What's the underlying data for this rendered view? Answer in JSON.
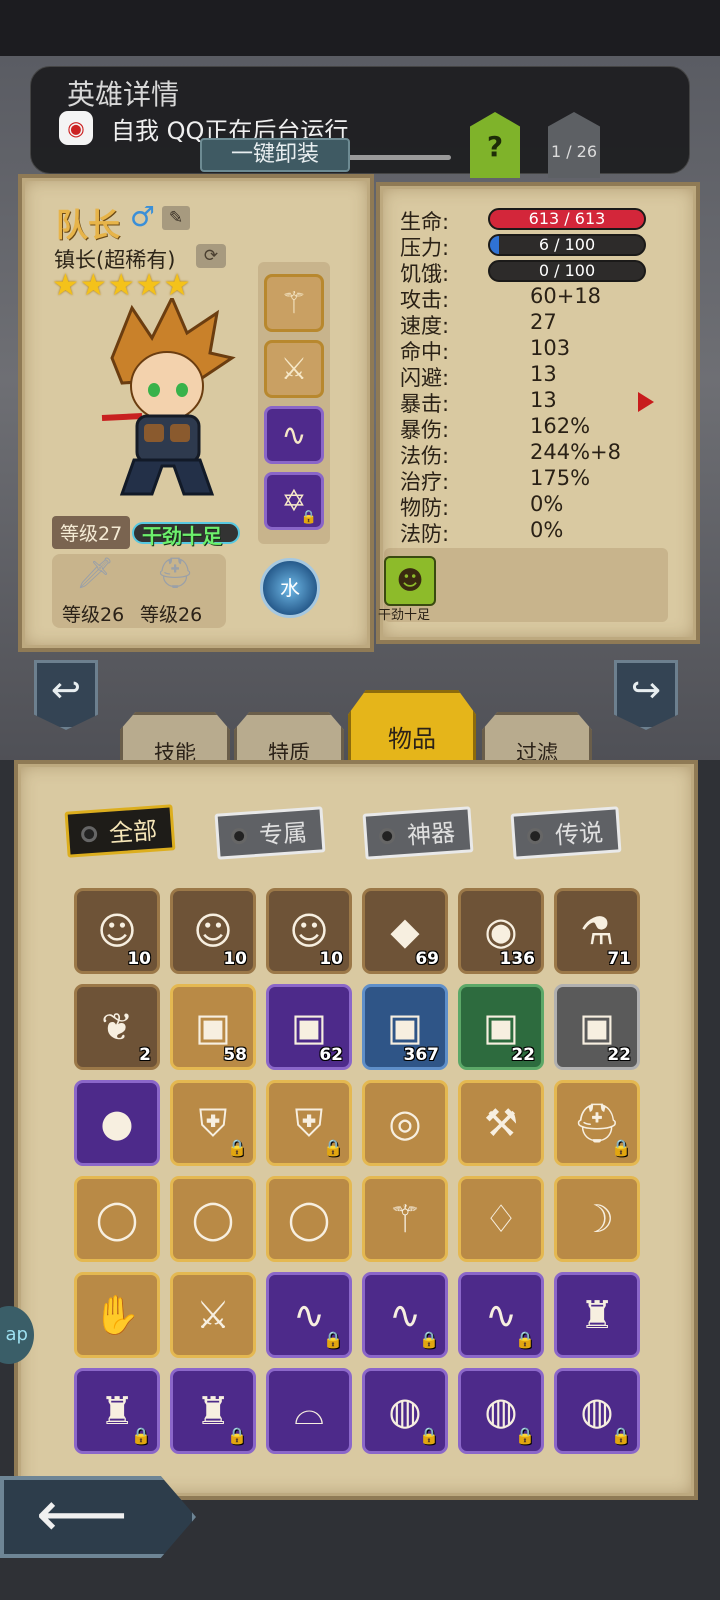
{
  "notification": {
    "app_title": "英雄详情",
    "app_icon": "qq-penguin-icon",
    "message": "自我  QQ正在后台运行"
  },
  "header": {
    "unequip_label": "一键卸装",
    "help_label": "?",
    "page_counter": "1 / 26"
  },
  "hero": {
    "name": "队长",
    "gender_symbol": "♂",
    "title": "镇长(超稀有)",
    "stars": "★★★★★",
    "level": "等级27",
    "mood": "干劲十足",
    "element": "水",
    "weapon_level": "等级26",
    "helmet_level": "等级26"
  },
  "stats": {
    "rows": [
      {
        "label": "生命:",
        "value": "613 / 613",
        "kind": "bar",
        "fill": 1.0,
        "color": "#d3263a"
      },
      {
        "label": "压力:",
        "value": "6 / 100",
        "kind": "bar",
        "fill": 0.06,
        "color": "#2f72d4"
      },
      {
        "label": "饥饿:",
        "value": "0 / 100",
        "kind": "bar",
        "fill": 0.0,
        "color": "#2f72d4"
      },
      {
        "label": "攻击:",
        "value": "60+18"
      },
      {
        "label": "速度:",
        "value": "27"
      },
      {
        "label": "命中:",
        "value": "103"
      },
      {
        "label": "闪避:",
        "value": "13"
      },
      {
        "label": "暴击:",
        "value": "13"
      },
      {
        "label": "暴伤:",
        "value": "162%"
      },
      {
        "label": "法伤:",
        "value": "244%+8"
      },
      {
        "label": "治疗:",
        "value": "175%"
      },
      {
        "label": "物防:",
        "value": "0%"
      },
      {
        "label": "法防:",
        "value": "0%"
      }
    ],
    "trait_label": "干劲十足"
  },
  "tabs": [
    "技能",
    "特质",
    "物品",
    "过滤"
  ],
  "filters": [
    "全部",
    "专属",
    "神器",
    "传说"
  ],
  "inventory": [
    {
      "icon": "green-hair-hero-icon",
      "glyph": "☺",
      "rarity": "brown",
      "count": "10"
    },
    {
      "icon": "blue-hair-hero-icon",
      "glyph": "☺",
      "rarity": "brown",
      "count": "10"
    },
    {
      "icon": "red-hair-hero-icon",
      "glyph": "☺",
      "rarity": "brown",
      "count": "10"
    },
    {
      "icon": "fire-crystal-icon",
      "glyph": "◆",
      "rarity": "brown",
      "count": "69"
    },
    {
      "icon": "dark-rune-stone-icon",
      "glyph": "◉",
      "rarity": "brown",
      "count": "136"
    },
    {
      "icon": "potion-bottle-icon",
      "glyph": "⚗",
      "rarity": "brown",
      "count": "71"
    },
    {
      "icon": "white-feather-icon",
      "glyph": "❦",
      "rarity": "brown",
      "count": "2"
    },
    {
      "icon": "treasure-chest-gold-icon",
      "glyph": "▣",
      "rarity": "gold",
      "count": "58"
    },
    {
      "icon": "treasure-chest-purple-icon",
      "glyph": "▣",
      "rarity": "purple",
      "count": "62"
    },
    {
      "icon": "treasure-chest-blue-icon",
      "glyph": "▣",
      "rarity": "blue",
      "count": "367"
    },
    {
      "icon": "treasure-chest-green-icon",
      "glyph": "▣",
      "rarity": "green",
      "count": "22"
    },
    {
      "icon": "treasure-chest-grey-icon",
      "glyph": "▣",
      "rarity": "grey",
      "count": "22"
    },
    {
      "icon": "green-gem-orb-icon",
      "glyph": "●",
      "rarity": "purple",
      "count": ""
    },
    {
      "icon": "shield-icon",
      "glyph": "⛨",
      "rarity": "gold",
      "locked": true
    },
    {
      "icon": "shield-icon",
      "glyph": "⛨",
      "rarity": "gold",
      "locked": true
    },
    {
      "icon": "emerald-ring-icon",
      "glyph": "◎",
      "rarity": "gold",
      "count": ""
    },
    {
      "icon": "pink-axe-icon",
      "glyph": "⚒",
      "rarity": "gold",
      "count": ""
    },
    {
      "icon": "blue-helmet-icon",
      "glyph": "⛑",
      "rarity": "gold",
      "locked": true
    },
    {
      "icon": "golden-dragon-ring-icon",
      "glyph": "◯",
      "rarity": "gold",
      "count": ""
    },
    {
      "icon": "golden-dragon-ring-icon",
      "glyph": "◯",
      "rarity": "gold",
      "count": ""
    },
    {
      "icon": "golden-dragon-ring-icon",
      "glyph": "◯",
      "rarity": "gold",
      "count": ""
    },
    {
      "icon": "skull-staff-icon",
      "glyph": "⚚",
      "rarity": "gold",
      "count": ""
    },
    {
      "icon": "star-pouch-icon",
      "glyph": "♢",
      "rarity": "gold",
      "count": ""
    },
    {
      "icon": "crescent-staff-icon",
      "glyph": "☽",
      "rarity": "gold",
      "count": ""
    },
    {
      "icon": "ice-claw-gauntlet-icon",
      "glyph": "✋",
      "rarity": "gold",
      "count": ""
    },
    {
      "icon": "red-sword-icon",
      "glyph": "⚔",
      "rarity": "gold",
      "count": ""
    },
    {
      "icon": "whip-icon",
      "glyph": "∿",
      "rarity": "purple",
      "locked": true
    },
    {
      "icon": "whip-icon",
      "glyph": "∿",
      "rarity": "purple",
      "locked": true
    },
    {
      "icon": "whip-icon",
      "glyph": "∿",
      "rarity": "purple",
      "locked": true
    },
    {
      "icon": "dark-armor-icon",
      "glyph": "♜",
      "rarity": "purple",
      "count": ""
    },
    {
      "icon": "dark-armor-icon",
      "glyph": "♜",
      "rarity": "purple",
      "locked": true
    },
    {
      "icon": "dark-armor-icon",
      "glyph": "♜",
      "rarity": "purple",
      "locked": true
    },
    {
      "icon": "fang-necklace-icon",
      "glyph": "⌓",
      "rarity": "purple",
      "count": ""
    },
    {
      "icon": "red-belt-icon",
      "glyph": "◍",
      "rarity": "purple",
      "locked": true
    },
    {
      "icon": "red-belt-icon",
      "glyph": "◍",
      "rarity": "purple",
      "locked": true
    },
    {
      "icon": "red-belt-icon",
      "glyph": "◍",
      "rarity": "purple",
      "locked": true
    }
  ],
  "equipped_slots": [
    {
      "icon": "skull-staff-icon",
      "glyph": "⚚",
      "rarity": "gold"
    },
    {
      "icon": "ice-sword-icon",
      "glyph": "⚔",
      "rarity": "gold"
    },
    {
      "icon": "whip-icon",
      "glyph": "∿",
      "rarity": "purple"
    },
    {
      "icon": "star-amulet-icon",
      "glyph": "✡",
      "rarity": "purple",
      "locked": true
    }
  ],
  "side_tab_label": "ap"
}
